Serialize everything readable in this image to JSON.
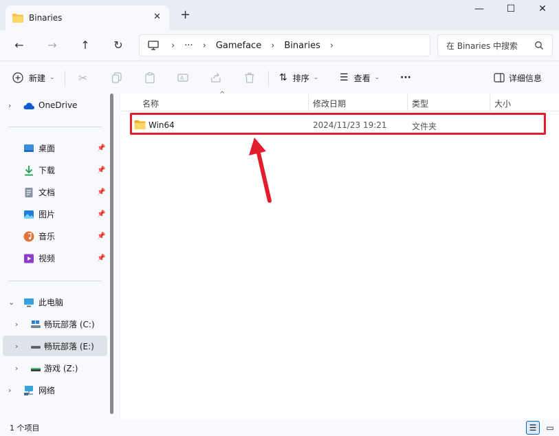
{
  "window": {
    "tab_title": "Binaries",
    "new_tab": "+",
    "minimize": "—",
    "maximize": "☐",
    "close": "✕"
  },
  "address": {
    "ellipsis": "···",
    "segments": [
      "Gameface",
      "Binaries"
    ],
    "search_placeholder": "在 Binaries 中搜索"
  },
  "toolbar": {
    "new_label": "新建",
    "sort_label": "排序",
    "view_label": "查看",
    "more_label": "···",
    "details_label": "详细信息"
  },
  "sidebar": {
    "onedrive": "OneDrive",
    "quick_access": [
      {
        "label": "桌面",
        "icon": "desktop-icon"
      },
      {
        "label": "下载",
        "icon": "download-icon"
      },
      {
        "label": "文档",
        "icon": "document-icon"
      },
      {
        "label": "图片",
        "icon": "pictures-icon"
      },
      {
        "label": "音乐",
        "icon": "music-icon"
      },
      {
        "label": "视频",
        "icon": "video-icon"
      }
    ],
    "this_pc": "此电脑",
    "drives": [
      {
        "label": "畅玩部落 (C:)"
      },
      {
        "label": "畅玩部落 (E:)"
      },
      {
        "label": "游戏 (Z:)"
      }
    ],
    "network": "网络"
  },
  "columns": {
    "name": "名称",
    "modified": "修改日期",
    "type": "类型",
    "size": "大小"
  },
  "files": [
    {
      "name": "Win64",
      "modified": "2024/11/23 19:21",
      "type": "文件夹",
      "size": ""
    }
  ],
  "status": {
    "count": "1 个项目"
  },
  "colors": {
    "highlight": "#e21e2d",
    "folder": "#f6c344",
    "accent": "#0067c0"
  }
}
